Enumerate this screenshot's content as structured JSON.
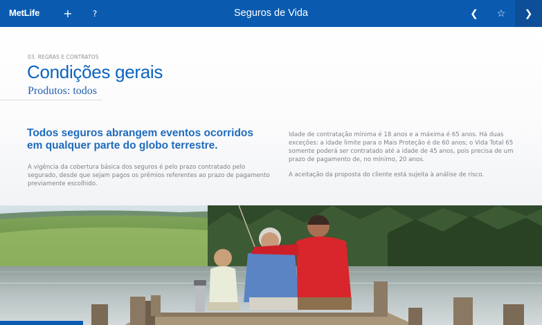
{
  "app": {
    "logo_text": "MetLife",
    "title": "Seguros de Vida",
    "colors": {
      "topbar": "#0a5bb0",
      "accent": "#0a64bf"
    }
  },
  "toolbar": {
    "add_icon": "plus-icon",
    "add_glyph": "+",
    "help_icon": "question-icon",
    "help_glyph": "?",
    "back_icon": "chevron-left-icon",
    "back_glyph": "❮",
    "favorite_icon": "star-icon",
    "favorite_glyph": "☆",
    "next_icon": "chevron-right-icon",
    "next_glyph": "❯"
  },
  "page": {
    "section_label": "03. REGRAS E CONTRATOS",
    "title": "Condições gerais",
    "subtitle": "Produtos: todos",
    "headline": "Todos seguros abrangem eventos ocorridos em qualquer parte do globo terrestre.",
    "left_paragraph": "A vigência da cobertura básica dos seguros é pelo prazo contratado pelo segurado, desde que sejam pagos os prêmios referentes ao prazo de pagamento previamente escolhido.",
    "right_paragraph_1": "Idade de contratação mínima é 18 anos e a máxima é 65 anos. Há duas exceções: a idade limite para o Mais Proteção é de 60 anos; o Vida Total 65 somente poderá ser contratado até a idade de 45 anos, pois precisa de um prazo de pagamento de, no mínimo, 20 anos.",
    "right_paragraph_2": "A aceitação da proposta do cliente está sujeita à análise de risco."
  },
  "photo": {
    "subject": "three-generations-fishing-on-pier-photo"
  }
}
